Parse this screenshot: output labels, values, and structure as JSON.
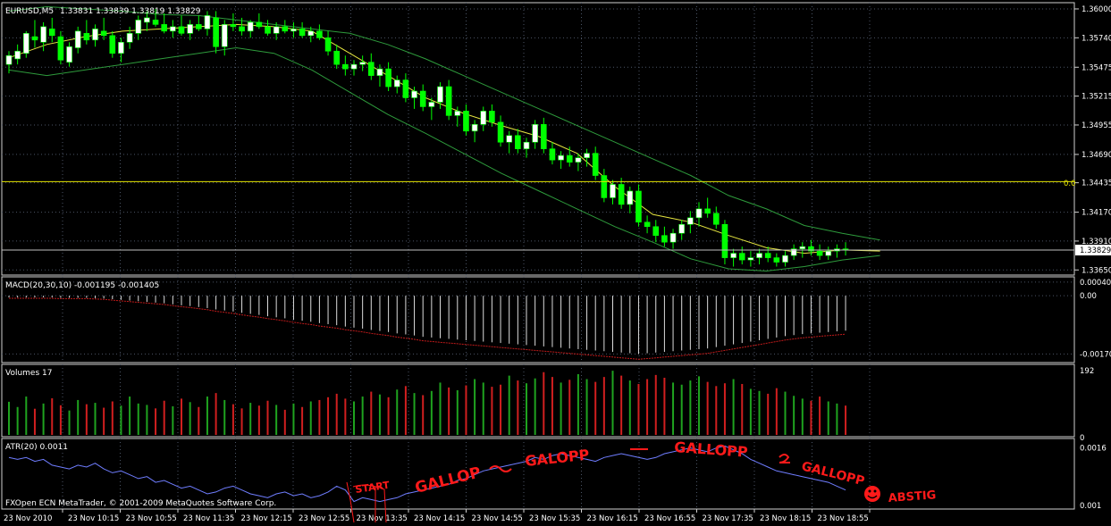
{
  "chart_data": {
    "type": "candlestick",
    "symbol_label": "EURUSD,M5",
    "ohlc_label": "1.33831 1.33839 1.33819 1.33829",
    "price_ticks": [
      "1.36000",
      "1.35740",
      "1.35475",
      "1.35215",
      "1.34955",
      "1.34690",
      "1.34435",
      "1.34170",
      "1.33910",
      "1.33650"
    ],
    "price_range": [
      1.3362,
      1.3604
    ],
    "last_price": "1.33829",
    "last_price_value": 1.33829,
    "level_label": "0.0",
    "level_value": 1.34445,
    "candles_ohlc": [
      [
        1.355,
        1.3562,
        1.3542,
        1.3558
      ],
      [
        1.3555,
        1.3568,
        1.355,
        1.3562
      ],
      [
        1.356,
        1.358,
        1.3556,
        1.3578
      ],
      [
        1.3575,
        1.359,
        1.3565,
        1.3572
      ],
      [
        1.357,
        1.3588,
        1.3562,
        1.3584
      ],
      [
        1.3582,
        1.3592,
        1.357,
        1.3576
      ],
      [
        1.3575,
        1.358,
        1.355,
        1.3554
      ],
      [
        1.3552,
        1.357,
        1.3548,
        1.3566
      ],
      [
        1.3565,
        1.3584,
        1.356,
        1.358
      ],
      [
        1.3578,
        1.359,
        1.3568,
        1.3572
      ],
      [
        1.3572,
        1.3586,
        1.3566,
        1.3582
      ],
      [
        1.358,
        1.3592,
        1.3572,
        1.3576
      ],
      [
        1.3576,
        1.358,
        1.3556,
        1.356
      ],
      [
        1.356,
        1.3574,
        1.3552,
        1.357
      ],
      [
        1.357,
        1.3584,
        1.3564,
        1.3578
      ],
      [
        1.3578,
        1.3594,
        1.3572,
        1.359
      ],
      [
        1.3588,
        1.3598,
        1.358,
        1.3592
      ],
      [
        1.359,
        1.36,
        1.3584,
        1.3586
      ],
      [
        1.3586,
        1.3596,
        1.3578,
        1.358
      ],
      [
        1.358,
        1.359,
        1.3574,
        1.3584
      ],
      [
        1.3584,
        1.3594,
        1.3576,
        1.3578
      ],
      [
        1.3578,
        1.359,
        1.3572,
        1.3586
      ],
      [
        1.3586,
        1.3594,
        1.358,
        1.3582
      ],
      [
        1.3582,
        1.3598,
        1.3576,
        1.3594
      ],
      [
        1.3592,
        1.3598,
        1.356,
        1.3566
      ],
      [
        1.3566,
        1.359,
        1.3558,
        1.3586
      ],
      [
        1.3586,
        1.3596,
        1.358,
        1.3584
      ],
      [
        1.3584,
        1.3592,
        1.3576,
        1.358
      ],
      [
        1.358,
        1.359,
        1.3574,
        1.3588
      ],
      [
        1.3588,
        1.3596,
        1.3582,
        1.3584
      ],
      [
        1.3584,
        1.359,
        1.3576,
        1.3578
      ],
      [
        1.3578,
        1.3588,
        1.3572,
        1.3584
      ],
      [
        1.3584,
        1.359,
        1.3578,
        1.358
      ],
      [
        1.358,
        1.3588,
        1.3574,
        1.3582
      ],
      [
        1.3582,
        1.3588,
        1.3574,
        1.3576
      ],
      [
        1.3576,
        1.3584,
        1.357,
        1.358
      ],
      [
        1.358,
        1.3586,
        1.3572,
        1.3574
      ],
      [
        1.3574,
        1.358,
        1.3558,
        1.3562
      ],
      [
        1.3562,
        1.3568,
        1.3546,
        1.355
      ],
      [
        1.355,
        1.3558,
        1.354,
        1.3546
      ],
      [
        1.3546,
        1.3554,
        1.354,
        1.355
      ],
      [
        1.355,
        1.3558,
        1.3544,
        1.3552
      ],
      [
        1.3552,
        1.356,
        1.3536,
        1.354
      ],
      [
        1.354,
        1.355,
        1.353,
        1.3546
      ],
      [
        1.3546,
        1.3552,
        1.3526,
        1.353
      ],
      [
        1.353,
        1.354,
        1.3524,
        1.3536
      ],
      [
        1.3536,
        1.3542,
        1.3516,
        1.352
      ],
      [
        1.352,
        1.353,
        1.351,
        1.3526
      ],
      [
        1.3526,
        1.3532,
        1.3508,
        1.3512
      ],
      [
        1.3512,
        1.352,
        1.35,
        1.3516
      ],
      [
        1.3516,
        1.3534,
        1.351,
        1.353
      ],
      [
        1.353,
        1.3536,
        1.35,
        1.3504
      ],
      [
        1.3504,
        1.3512,
        1.3494,
        1.3508
      ],
      [
        1.3508,
        1.3514,
        1.3486,
        1.349
      ],
      [
        1.349,
        1.35,
        1.348,
        1.3496
      ],
      [
        1.3496,
        1.3512,
        1.349,
        1.3508
      ],
      [
        1.3508,
        1.3514,
        1.3494,
        1.3498
      ],
      [
        1.3498,
        1.3504,
        1.3476,
        1.348
      ],
      [
        1.348,
        1.349,
        1.347,
        1.3486
      ],
      [
        1.3486,
        1.3492,
        1.347,
        1.3474
      ],
      [
        1.3474,
        1.3484,
        1.3466,
        1.348
      ],
      [
        1.348,
        1.35,
        1.3474,
        1.3496
      ],
      [
        1.3496,
        1.3502,
        1.347,
        1.3474
      ],
      [
        1.3474,
        1.348,
        1.346,
        1.3464
      ],
      [
        1.3464,
        1.3472,
        1.3456,
        1.3468
      ],
      [
        1.3468,
        1.3476,
        1.3458,
        1.3462
      ],
      [
        1.3462,
        1.347,
        1.3454,
        1.3466
      ],
      [
        1.3466,
        1.3474,
        1.3458,
        1.347
      ],
      [
        1.347,
        1.3476,
        1.3446,
        1.345
      ],
      [
        1.345,
        1.3456,
        1.3426,
        1.343
      ],
      [
        1.343,
        1.3446,
        1.3424,
        1.3442
      ],
      [
        1.3442,
        1.3448,
        1.342,
        1.3424
      ],
      [
        1.3424,
        1.344,
        1.3416,
        1.3436
      ],
      [
        1.3436,
        1.3442,
        1.3404,
        1.3408
      ],
      [
        1.3408,
        1.3414,
        1.3398,
        1.3404
      ],
      [
        1.3404,
        1.341,
        1.339,
        1.3396
      ],
      [
        1.3396,
        1.3404,
        1.3386,
        1.339
      ],
      [
        1.339,
        1.3402,
        1.3384,
        1.3398
      ],
      [
        1.3398,
        1.341,
        1.3392,
        1.3406
      ],
      [
        1.3406,
        1.3418,
        1.3398,
        1.3412
      ],
      [
        1.3412,
        1.3426,
        1.3404,
        1.342
      ],
      [
        1.342,
        1.343,
        1.3412,
        1.3416
      ],
      [
        1.3416,
        1.3422,
        1.3402,
        1.3406
      ],
      [
        1.3406,
        1.341,
        1.337,
        1.3376
      ],
      [
        1.3376,
        1.3384,
        1.3368,
        1.338
      ],
      [
        1.338,
        1.3386,
        1.337,
        1.3374
      ],
      [
        1.3374,
        1.3382,
        1.3368,
        1.3376
      ],
      [
        1.3376,
        1.3384,
        1.337,
        1.338
      ],
      [
        1.338,
        1.3386,
        1.3372,
        1.3376
      ],
      [
        1.3376,
        1.338,
        1.3368,
        1.3372
      ],
      [
        1.3372,
        1.3382,
        1.3368,
        1.3378
      ],
      [
        1.3378,
        1.3388,
        1.3374,
        1.3384
      ],
      [
        1.3384,
        1.339,
        1.3376,
        1.3386
      ],
      [
        1.3386,
        1.3392,
        1.3378,
        1.3382
      ],
      [
        1.3382,
        1.3388,
        1.3374,
        1.3378
      ],
      [
        1.3378,
        1.3386,
        1.3374,
        1.3382
      ],
      [
        1.3382,
        1.3388,
        1.3376,
        1.3384
      ],
      [
        1.3384,
        1.339,
        1.3378,
        1.3383
      ]
    ],
    "bands_upper": [
      1.3598,
      1.3602,
      1.36,
      1.3598,
      1.3595,
      1.3594,
      1.359,
      1.3586,
      1.3582,
      1.3578,
      1.3568,
      1.3555,
      1.354,
      1.3525,
      1.351,
      1.3495,
      1.348,
      1.3465,
      1.345,
      1.3432,
      1.342,
      1.3405,
      1.3398,
      1.3392
    ],
    "bands_lower": [
      1.3545,
      1.354,
      1.3545,
      1.355,
      1.3555,
      1.356,
      1.3565,
      1.356,
      1.3545,
      1.3525,
      1.3505,
      1.3488,
      1.347,
      1.3452,
      1.3436,
      1.342,
      1.3404,
      1.339,
      1.3375,
      1.3366,
      1.3364,
      1.3368,
      1.3374,
      1.3378
    ],
    "ma_fast": [
      1.3556,
      1.3568,
      1.3575,
      1.358,
      1.3582,
      1.3584,
      1.3586,
      1.3584,
      1.358,
      1.356,
      1.354,
      1.352,
      1.3506,
      1.3495,
      1.3485,
      1.347,
      1.344,
      1.3415,
      1.3408,
      1.3396,
      1.3385,
      1.338,
      1.3383,
      1.3382
    ],
    "macd_label": "MACD(20,30,10) -0.001195 -0.001405",
    "macd_ticks": [
      "0.00040",
      "0.00",
      "-0.00170"
    ],
    "macd_range": [
      -0.0019,
      0.0005
    ],
    "macd_hist": [
      -5e-05,
      -5e-05,
      -5e-05,
      -5e-05,
      -5e-05,
      -5e-05,
      -6e-05,
      -6e-05,
      -6e-05,
      -6e-05,
      -7e-05,
      -8e-05,
      -0.0001,
      -0.00012,
      -0.00014,
      -0.00016,
      -0.00018,
      -0.0002,
      -0.00022,
      -0.00025,
      -0.00028,
      -0.0003,
      -0.00033,
      -0.00036,
      -0.0004,
      -0.00043,
      -0.00046,
      -0.0005,
      -0.00053,
      -0.00056,
      -0.0006,
      -0.00063,
      -0.00066,
      -0.0007,
      -0.00073,
      -0.00076,
      -0.0008,
      -0.00083,
      -0.00086,
      -0.0009,
      -0.00093,
      -0.00096,
      -0.001,
      -0.00103,
      -0.00106,
      -0.0011,
      -0.00113,
      -0.00116,
      -0.0012,
      -0.00122,
      -0.00124,
      -0.00126,
      -0.00128,
      -0.0013,
      -0.00132,
      -0.00134,
      -0.00136,
      -0.00138,
      -0.0014,
      -0.00142,
      -0.00144,
      -0.00146,
      -0.00148,
      -0.0015,
      -0.00152,
      -0.00154,
      -0.00156,
      -0.00158,
      -0.0016,
      -0.00162,
      -0.00164,
      -0.00166,
      -0.00168,
      -0.0017,
      -0.00168,
      -0.00166,
      -0.00164,
      -0.00162,
      -0.0016,
      -0.00158,
      -0.00156,
      -0.00154,
      -0.0015,
      -0.00146,
      -0.00142,
      -0.00138,
      -0.00134,
      -0.0013,
      -0.00126,
      -0.00122,
      -0.00118,
      -0.00115,
      -0.00112,
      -0.0011,
      -0.00108,
      -0.00106,
      -0.00104,
      -0.00102
    ],
    "volume_label": "Volumes 17",
    "volume_ticks": [
      "192",
      "0"
    ],
    "volume_max": 192,
    "volumes": [
      95,
      80,
      110,
      75,
      90,
      105,
      85,
      70,
      100,
      88,
      92,
      78,
      96,
      84,
      110,
      90,
      86,
      76,
      98,
      82,
      104,
      94,
      80,
      110,
      120,
      100,
      88,
      76,
      92,
      84,
      98,
      86,
      72,
      90,
      80,
      96,
      100,
      108,
      118,
      104,
      96,
      110,
      124,
      116,
      108,
      130,
      140,
      120,
      114,
      126,
      150,
      136,
      128,
      142,
      160,
      150,
      138,
      144,
      170,
      156,
      148,
      162,
      180,
      166,
      150,
      158,
      174,
      160,
      152,
      166,
      184,
      170,
      156,
      146,
      160,
      172,
      164,
      150,
      144,
      156,
      168,
      152,
      140,
      148,
      160,
      146,
      132,
      126,
      118,
      134,
      124,
      112,
      104,
      98,
      110,
      96,
      90,
      84
    ],
    "volume_colors": [
      "#d11f1f",
      "#1fa31f"
    ],
    "atr_label": "ATR(20) 0.0011",
    "atr_ticks": [
      "0.0016",
      "0.001"
    ],
    "atr_range": [
      0.00098,
      0.00168
    ],
    "atr": [
      0.0015,
      0.00148,
      0.0015,
      0.00146,
      0.00148,
      0.00142,
      0.0014,
      0.00138,
      0.00142,
      0.0014,
      0.00144,
      0.00138,
      0.00134,
      0.00136,
      0.00132,
      0.00128,
      0.0013,
      0.00124,
      0.00126,
      0.00122,
      0.00118,
      0.0012,
      0.00116,
      0.00112,
      0.00114,
      0.00118,
      0.0012,
      0.00116,
      0.00112,
      0.0011,
      0.00108,
      0.00112,
      0.00114,
      0.0011,
      0.00112,
      0.00108,
      0.0011,
      0.00114,
      0.0012,
      0.00116,
      0.00104,
      0.00108,
      0.00106,
      0.00104,
      0.00106,
      0.00108,
      0.00112,
      0.00114,
      0.00116,
      0.00118,
      0.0012,
      0.00122,
      0.00126,
      0.00128,
      0.00132,
      0.00136,
      0.00138,
      0.0014,
      0.00142,
      0.00144,
      0.00146,
      0.0015,
      0.00148,
      0.00152,
      0.00154,
      0.00152,
      0.0015,
      0.00148,
      0.00146,
      0.0015,
      0.00152,
      0.00154,
      0.00152,
      0.0015,
      0.00148,
      0.0015,
      0.00154,
      0.00156,
      0.00158,
      0.0016,
      0.00158,
      0.00156,
      0.0016,
      0.00162,
      0.00158,
      0.00154,
      0.00148,
      0.00144,
      0.0014,
      0.00136,
      0.00134,
      0.00132,
      0.0013,
      0.00128,
      0.00126,
      0.00124,
      0.0012,
      0.00116
    ],
    "time_labels": [
      "23 Nov 2010",
      "23 Nov 10:15",
      "23 Nov 10:55",
      "23 Nov 11:35",
      "23 Nov 12:15",
      "23 Nov 12:55",
      "23 Nov 13:35",
      "23 Nov 14:15",
      "23 Nov 14:55",
      "23 Nov 15:35",
      "23 Nov 16:15",
      "23 Nov 16:55",
      "23 Nov 17:35",
      "23 Nov 18:15",
      "23 Nov 18:55"
    ],
    "copyright": "FXOpen ECN MetaTrader, © 2001-2009 MetaQuotes Software Corp.",
    "annotations": [
      "START",
      "GALLOP",
      "GALOPP",
      "GALLOPP",
      "GALLOPP",
      "ABSTIG"
    ],
    "colors": {
      "bull_candle": "#ffffff",
      "bear_candle": "#00ff00",
      "band": "#2e9b3c",
      "ma": "#e6e640",
      "level": "#e6e600",
      "macd_signal": "#c11a1a",
      "atr": "#6f7dff",
      "annotation": "#ff1a1a",
      "grid": "#4b5566"
    },
    "grid": true
  }
}
